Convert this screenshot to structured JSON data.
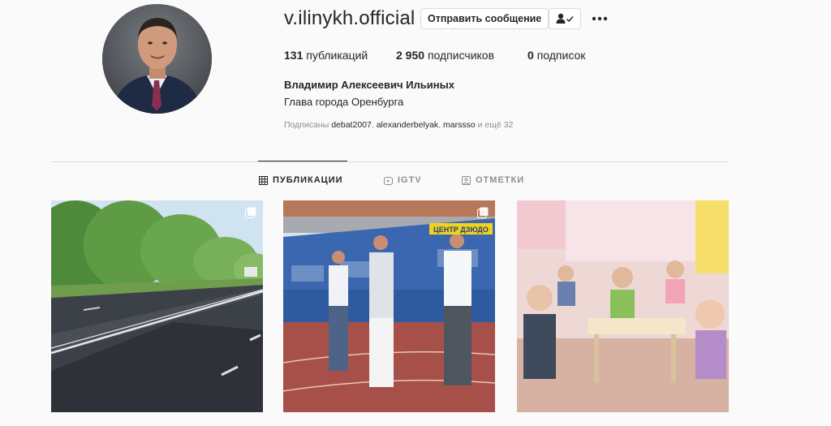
{
  "profile": {
    "username": "v.ilinykh.official",
    "message_button": "Отправить сообщение",
    "full_name": "Владимир Алексеевич Ильиных",
    "bio": "Глава города Оренбурга"
  },
  "stats": {
    "posts_count": "131",
    "posts_label": "публикаций",
    "followers_count": "2 950",
    "followers_label": "подписчиков",
    "following_count": "0",
    "following_label": "подписок"
  },
  "followed_by": {
    "prefix": "Подписаны",
    "account1": "debat2007",
    "account2": "alexanderbelyak",
    "account3": "marssso",
    "suffix": "и ещё 32"
  },
  "tabs": [
    {
      "label": "ПУБЛИКАЦИИ",
      "icon": "grid-icon",
      "active": true
    },
    {
      "label": "IGTV",
      "icon": "igtv-icon",
      "active": false
    },
    {
      "label": "ОТМЕТКИ",
      "icon": "tagged-icon",
      "active": false
    }
  ],
  "posts": [
    {
      "type": "album",
      "sign_text": "",
      "icon": "multiple-photos-icon"
    },
    {
      "type": "album",
      "sign_text": "ЦЕНТР ДЗЮДО",
      "icon": "multiple-photos-icon"
    },
    {
      "type": "photo",
      "sign_text": "",
      "icon": ""
    }
  ],
  "colors": {
    "background": "#fafafa",
    "text": "#262626",
    "secondary_text": "#8e8e8e",
    "border": "#dbdbdb"
  }
}
